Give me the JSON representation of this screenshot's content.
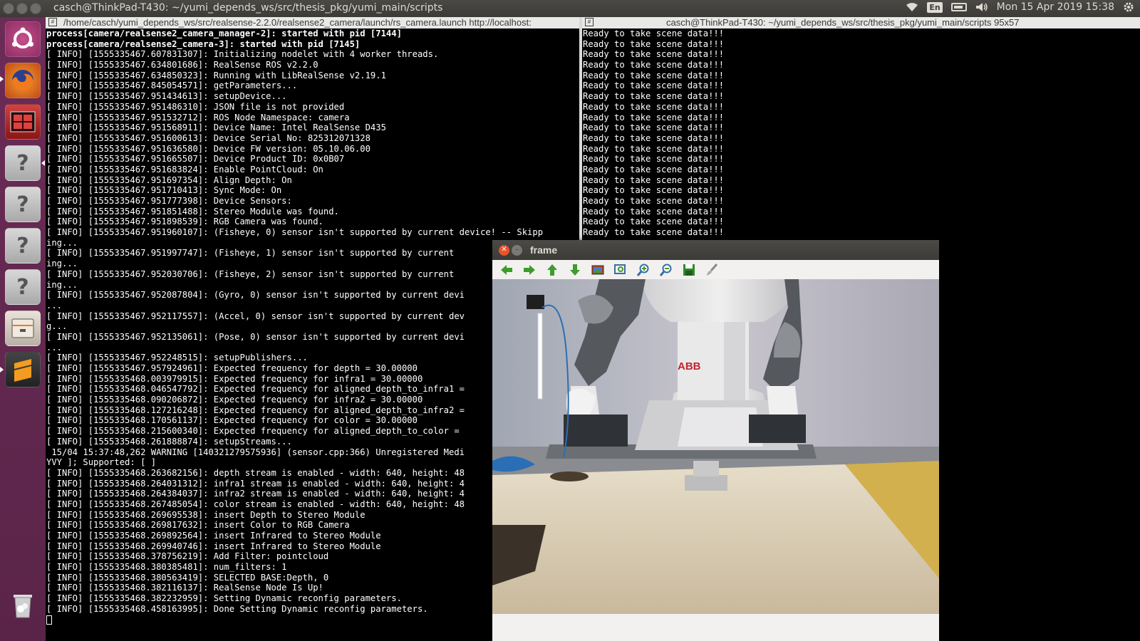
{
  "top_panel": {
    "title": "casch@ThinkPad-T430: ~/yumi_depends_ws/src/thesis_pkg/yumi_main/scripts",
    "keyboard": "En",
    "datetime": "Mon 15 Apr 2019 15:38",
    "icons": [
      "wifi-icon",
      "keyboard-icon",
      "battery-icon",
      "volume-icon",
      "gear-icon"
    ]
  },
  "launcher": {
    "items": [
      "ubuntu-dash-icon",
      "firefox-icon",
      "terminal-icon",
      "unknown-app-icon",
      "unknown-app-icon",
      "unknown-app-icon",
      "unknown-app-icon",
      "files-icon",
      "sublime-text-icon",
      "trash-icon"
    ]
  },
  "term_left": {
    "title": "/home/casch/yumi_depends_ws/src/realsense-2.2.0/realsense2_camera/launch/rs_camera.launch http://localhost:",
    "lines": [
      {
        "text": "process[camera/realsense2_camera_manager-2]: started with pid [7144]",
        "bold": true
      },
      {
        "text": "process[camera/realsense2_camera-3]: started with pid [7145]",
        "bold": true
      },
      {
        "text": "[ INFO] [1555335467.607831307]: Initializing nodelet with 4 worker threads."
      },
      {
        "text": "[ INFO] [1555335467.634801686]: RealSense ROS v2.2.0"
      },
      {
        "text": "[ INFO] [1555335467.634850323]: Running with LibRealSense v2.19.1"
      },
      {
        "text": "[ INFO] [1555335467.845054571]: getParameters..."
      },
      {
        "text": "[ INFO] [1555335467.951434613]: setupDevice..."
      },
      {
        "text": "[ INFO] [1555335467.951486310]: JSON file is not provided"
      },
      {
        "text": "[ INFO] [1555335467.951532712]: ROS Node Namespace: camera"
      },
      {
        "text": "[ INFO] [1555335467.951568911]: Device Name: Intel RealSense D435"
      },
      {
        "text": "[ INFO] [1555335467.951600613]: Device Serial No: 825312071328"
      },
      {
        "text": "[ INFO] [1555335467.951636580]: Device FW version: 05.10.06.00"
      },
      {
        "text": "[ INFO] [1555335467.951665507]: Device Product ID: 0x0B07"
      },
      {
        "text": "[ INFO] [1555335467.951683824]: Enable PointCloud: On"
      },
      {
        "text": "[ INFO] [1555335467.951697354]: Align Depth: On"
      },
      {
        "text": "[ INFO] [1555335467.951710413]: Sync Mode: On"
      },
      {
        "text": "[ INFO] [1555335467.951777398]: Device Sensors:"
      },
      {
        "text": "[ INFO] [1555335467.951851488]: Stereo Module was found."
      },
      {
        "text": "[ INFO] [1555335467.951898539]: RGB Camera was found."
      },
      {
        "text": "[ INFO] [1555335467.951960107]: (Fisheye, 0) sensor isn't supported by current device! -- Skipp"
      },
      {
        "text": "ing..."
      },
      {
        "text": "[ INFO] [1555335467.951997747]: (Fisheye, 1) sensor isn't supported by current"
      },
      {
        "text": "ing..."
      },
      {
        "text": "[ INFO] [1555335467.952030706]: (Fisheye, 2) sensor isn't supported by current"
      },
      {
        "text": "ing..."
      },
      {
        "text": "[ INFO] [1555335467.952087804]: (Gyro, 0) sensor isn't supported by current devi"
      },
      {
        "text": "..."
      },
      {
        "text": "[ INFO] [1555335467.952117557]: (Accel, 0) sensor isn't supported by current dev"
      },
      {
        "text": "g..."
      },
      {
        "text": "[ INFO] [1555335467.952135061]: (Pose, 0) sensor isn't supported by current devi"
      },
      {
        "text": "..."
      },
      {
        "text": "[ INFO] [1555335467.952248515]: setupPublishers..."
      },
      {
        "text": "[ INFO] [1555335467.957924961]: Expected frequency for depth = 30.00000"
      },
      {
        "text": "[ INFO] [1555335468.003979915]: Expected frequency for infra1 = 30.00000"
      },
      {
        "text": "[ INFO] [1555335468.046547792]: Expected frequency for aligned_depth_to_infra1 ="
      },
      {
        "text": "[ INFO] [1555335468.090206872]: Expected frequency for infra2 = 30.00000"
      },
      {
        "text": "[ INFO] [1555335468.127216248]: Expected frequency for aligned_depth_to_infra2 ="
      },
      {
        "text": "[ INFO] [1555335468.170561137]: Expected frequency for color = 30.00000"
      },
      {
        "text": "[ INFO] [1555335468.215600340]: Expected frequency for aligned_depth_to_color ="
      },
      {
        "text": "[ INFO] [1555335468.261888874]: setupStreams..."
      },
      {
        "text": " 15/04 15:37:48,262 WARNING [140321279575936] (sensor.cpp:366) Unregistered Medi"
      },
      {
        "text": "YVY ]; Supported: [ ]"
      },
      {
        "text": "[ INFO] [1555335468.263682156]: depth stream is enabled - width: 640, height: 48"
      },
      {
        "text": "[ INFO] [1555335468.264031312]: infra1 stream is enabled - width: 640, height: 4"
      },
      {
        "text": "[ INFO] [1555335468.264384037]: infra2 stream is enabled - width: 640, height: 4"
      },
      {
        "text": "[ INFO] [1555335468.267485054]: color stream is enabled - width: 640, height: 48"
      },
      {
        "text": "[ INFO] [1555335468.269695538]: insert Depth to Stereo Module"
      },
      {
        "text": "[ INFO] [1555335468.269817632]: insert Color to RGB Camera"
      },
      {
        "text": "[ INFO] [1555335468.269892564]: insert Infrared to Stereo Module"
      },
      {
        "text": "[ INFO] [1555335468.269940746]: insert Infrared to Stereo Module"
      },
      {
        "text": "[ INFO] [1555335468.378756219]: Add Filter: pointcloud"
      },
      {
        "text": "[ INFO] [1555335468.380385481]: num_filters: 1"
      },
      {
        "text": "[ INFO] [1555335468.380563419]: SELECTED BASE:Depth, 0"
      },
      {
        "text": "[ INFO] [1555335468.382116137]: RealSense Node Is Up!"
      },
      {
        "text": "[ INFO] [1555335468.382232959]: Setting Dynamic reconfig parameters."
      },
      {
        "text": "[ INFO] [1555335468.458163995]: Done Setting Dynamic reconfig parameters."
      }
    ]
  },
  "term_right": {
    "title": "casch@ThinkPad-T430: ~/yumi_depends_ws/src/thesis_pkg/yumi_main/scripts 95x57",
    "lines": [
      "Ready to take scene data!!!",
      "Ready to take scene data!!!",
      "Ready to take scene data!!!",
      "Ready to take scene data!!!",
      "Ready to take scene data!!!",
      "Ready to take scene data!!!",
      "Ready to take scene data!!!",
      "Ready to take scene data!!!",
      "Ready to take scene data!!!",
      "Ready to take scene data!!!",
      "Ready to take scene data!!!",
      "Ready to take scene data!!!",
      "Ready to take scene data!!!",
      "Ready to take scene data!!!",
      "Ready to take scene data!!!",
      "Ready to take scene data!!!",
      "Ready to take scene data!!!",
      "Ready to take scene data!!!",
      "Ready to take scene data!!!",
      "Ready to take scene data!!!"
    ]
  },
  "frame_window": {
    "title": "frame",
    "toolbar": [
      "arrow-left-icon",
      "arrow-right-icon",
      "arrow-up-icon",
      "arrow-down-icon",
      "image-icon",
      "zoom-fit-icon",
      "zoom-in-icon",
      "zoom-out-icon",
      "save-icon",
      "brush-icon"
    ],
    "robot_logo": "ABB"
  }
}
